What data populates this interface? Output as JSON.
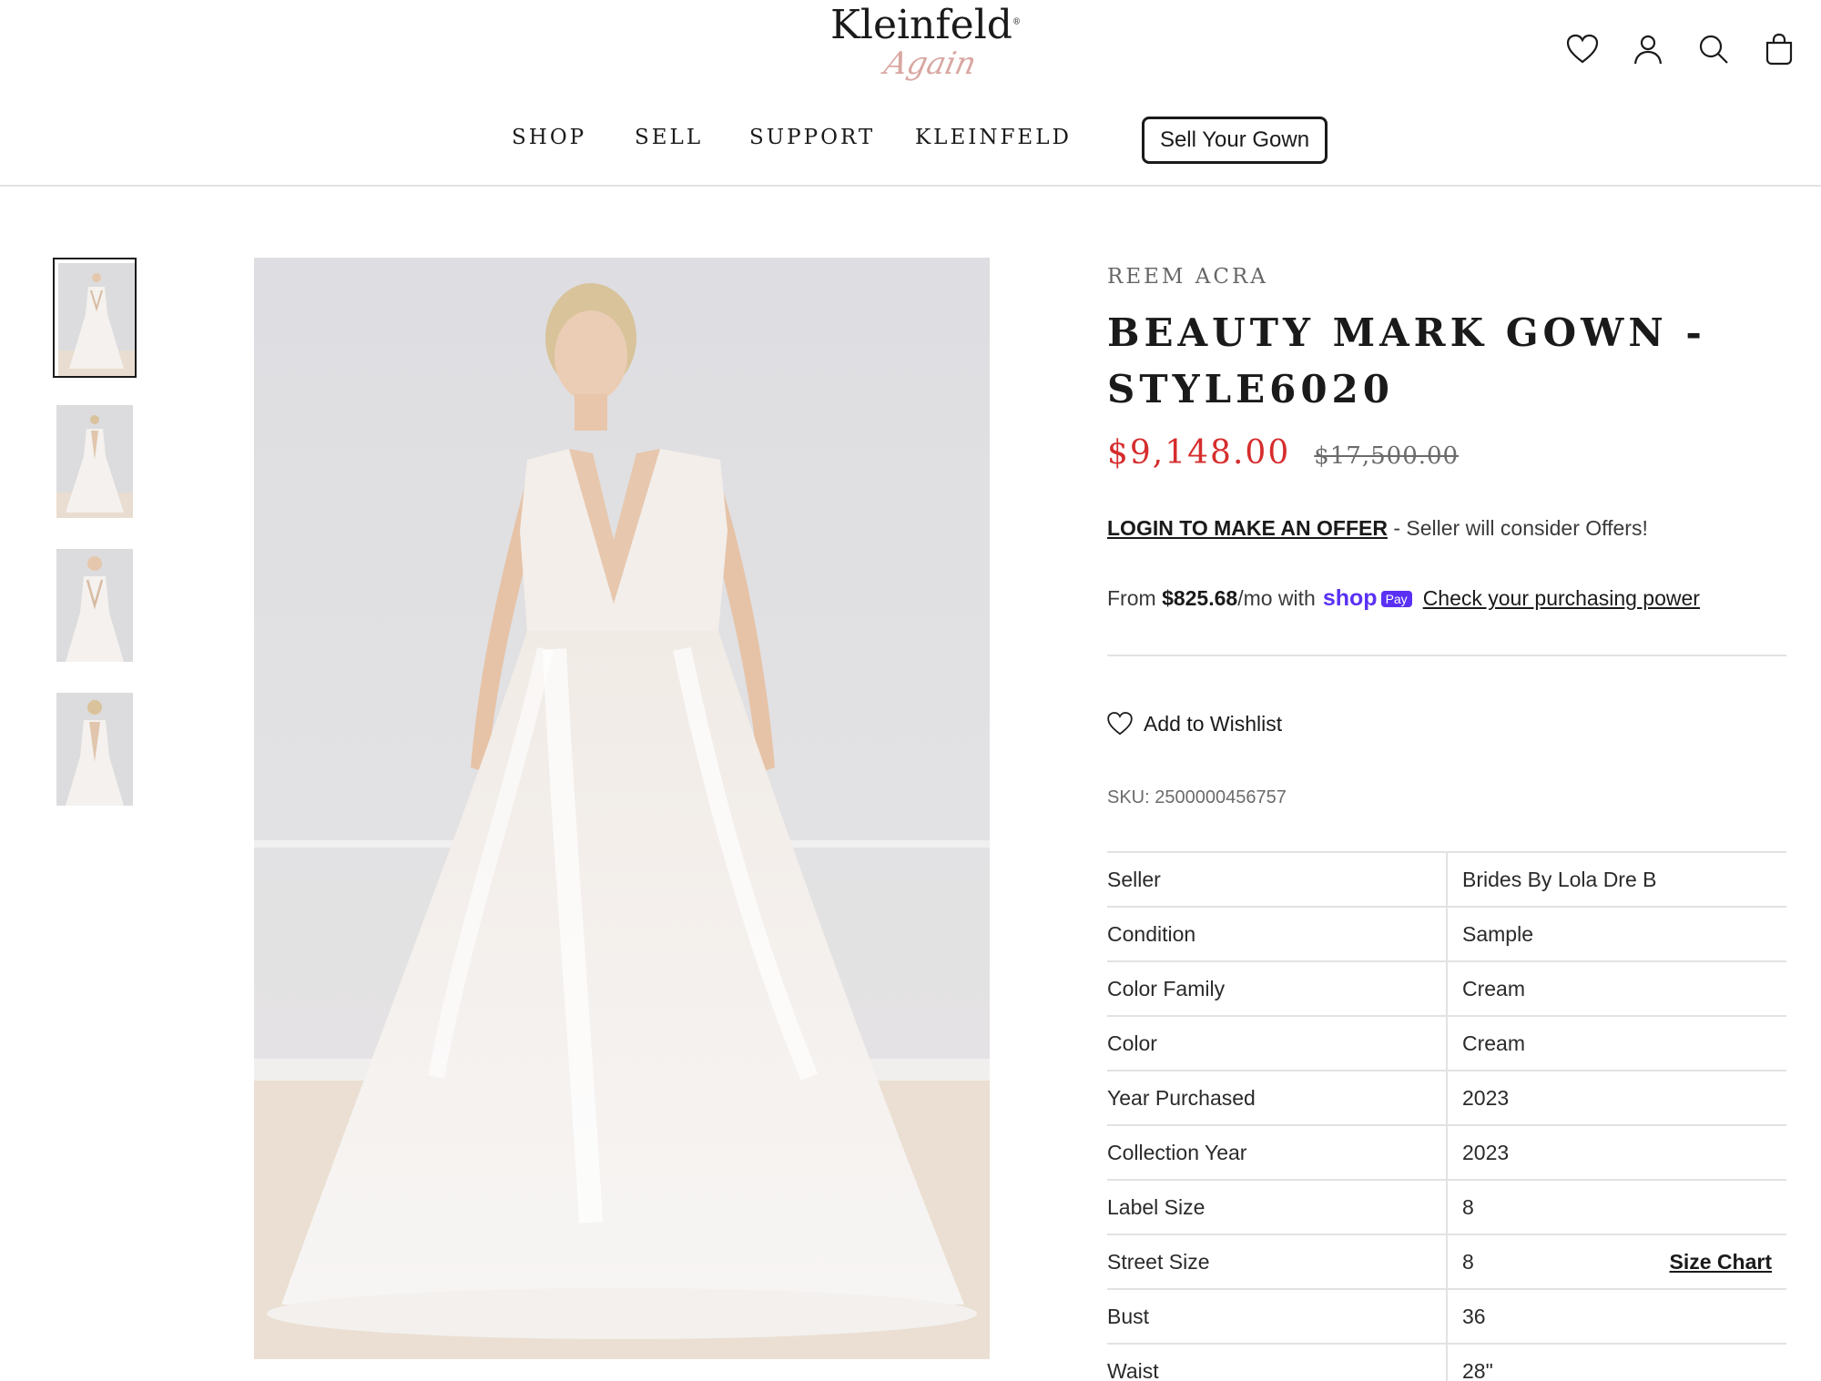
{
  "header": {
    "logo_main": "Kleinfeld",
    "logo_mark": "®",
    "logo_script": "Again",
    "nav": [
      "SHOP",
      "SELL",
      "SUPPORT",
      "KLEINFELD"
    ],
    "cta": "Sell Your Gown",
    "icons": [
      "heart-icon",
      "account-icon",
      "search-icon",
      "bag-icon"
    ]
  },
  "gallery": {
    "thumbnails": [
      "front view",
      "back view",
      "front close view",
      "back close view"
    ],
    "active_index": 0
  },
  "product": {
    "brand": "REEM ACRA",
    "title": "BEAUTY MARK GOWN - STYLE6020",
    "price_sale": "$9,148.00",
    "price_original": "$17,500.00",
    "offer_link": "LOGIN TO MAKE AN OFFER",
    "offer_text": " - Seller will consider Offers!",
    "installment_prefix": "From ",
    "installment_amount": "$825.68",
    "installment_suffix": "/mo with ",
    "shop_logo": "shop",
    "shop_pay": "Pay",
    "purchasing_power_link": "Check your purchasing power",
    "wishlist_label": "Add to Wishlist",
    "sku": "SKU: 2500000456757",
    "size_chart": "Size Chart",
    "specs": [
      {
        "label": "Seller",
        "value": "Brides By Lola Dre B"
      },
      {
        "label": "Condition",
        "value": "Sample"
      },
      {
        "label": "Color Family",
        "value": "Cream"
      },
      {
        "label": "Color",
        "value": "Cream"
      },
      {
        "label": "Year Purchased",
        "value": "2023"
      },
      {
        "label": "Collection Year",
        "value": "2023"
      },
      {
        "label": "Label Size",
        "value": "8"
      },
      {
        "label": "Street Size",
        "value": "8"
      },
      {
        "label": "Bust",
        "value": "36"
      },
      {
        "label": "Waist",
        "value": "28\""
      }
    ]
  },
  "colors": {
    "sale_price": "#d62d2d",
    "shop_pay": "#5a31f4",
    "logo_script": "#d9a7a2"
  }
}
